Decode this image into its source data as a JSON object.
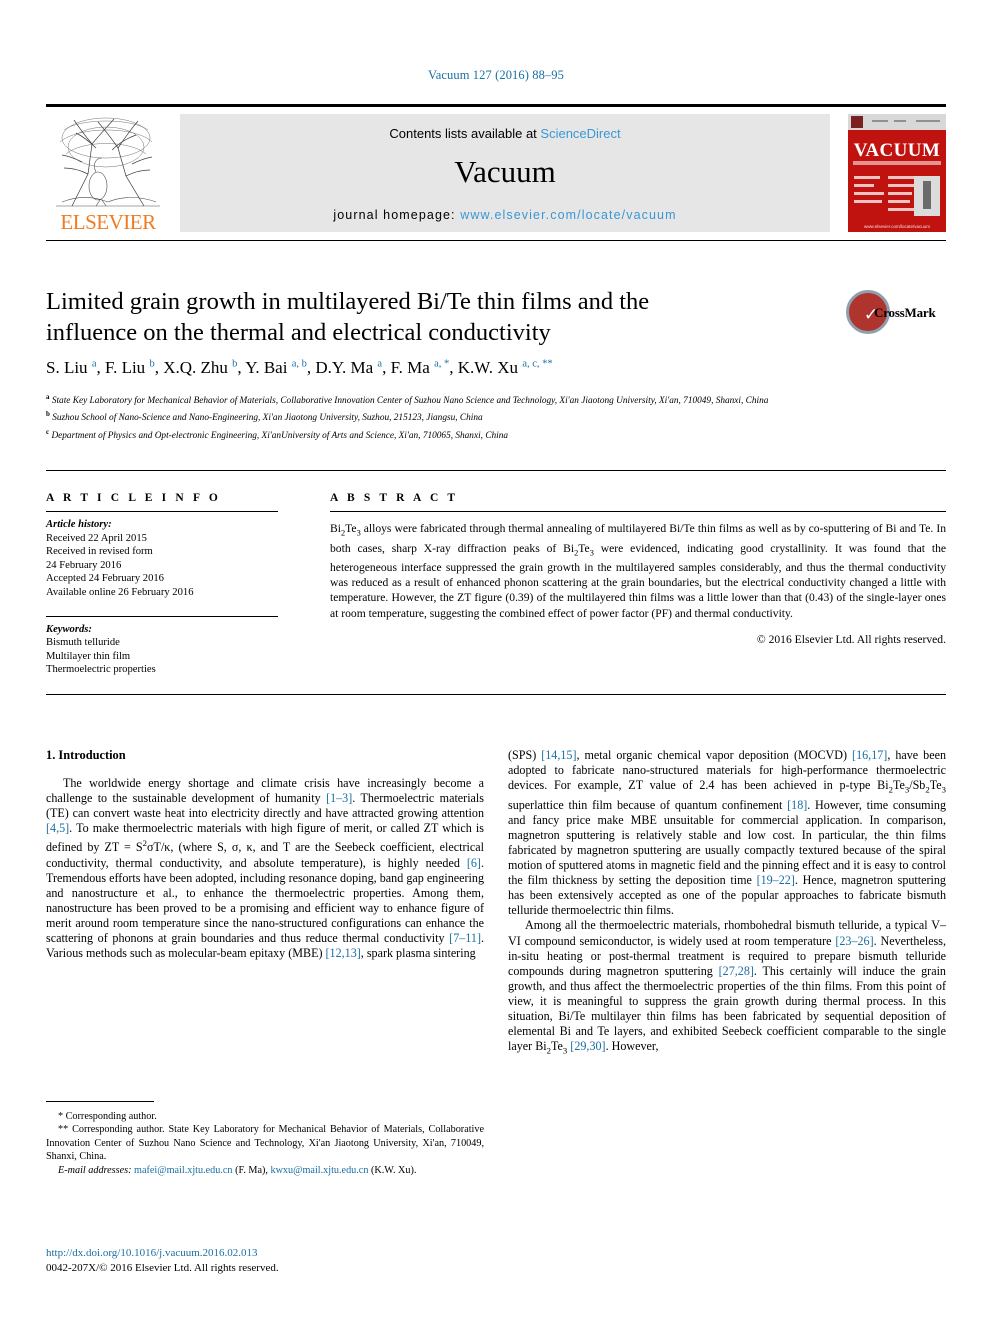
{
  "running_head": "Vacuum 127 (2016) 88–95",
  "journal_header": {
    "contents_prefix": "Contents lists available at ",
    "contents_link": "ScienceDirect",
    "journal_name": "Vacuum",
    "homepage_prefix": "journal homepage: ",
    "homepage_url": "www.elsevier.com/locate/vacuum",
    "publisher": "ELSEVIER",
    "cover_title": "VACUUM",
    "cover_caption": "www.elsevier.com/locate/vacuum",
    "accent_link_color": "#3a97d4",
    "elsevier_orange": "#ef7c22",
    "cover_red": "#c0130f"
  },
  "article": {
    "title": "Limited grain growth in multilayered Bi/Te thin films and the influence on the thermal and electrical conductivity",
    "crossmark_label": "CrossMark",
    "authors_html": "S. Liu <sup>a</sup>, F. Liu <sup>b</sup>, X.Q. Zhu <sup>b</sup>, Y. Bai <sup>a, b</sup>, D.Y. Ma <sup>a</sup>, F. Ma <sup>a, *</sup>, K.W. Xu <sup>a, c, **</sup>",
    "affiliations": [
      {
        "mark": "a",
        "text": "State Key Laboratory for Mechanical Behavior of Materials, Collaborative Innovation Center of Suzhou Nano Science and Technology, Xi'an Jiaotong University, Xi'an, 710049, Shanxi, China"
      },
      {
        "mark": "b",
        "text": "Suzhou School of Nano-Science and Nano-Engineering, Xi'an Jiaotong University, Suzhou, 215123, Jiangsu, China"
      },
      {
        "mark": "c",
        "text": "Department of Physics and Opt-electronic Engineering, Xi'anUniversity of Arts and Science, Xi'an, 710065, Shanxi, China"
      }
    ]
  },
  "article_info": {
    "heading": "A R T I C L E   I N F O",
    "history_label": "Article history:",
    "history": [
      "Received 22 April 2015",
      "Received in revised form",
      "24 February 2016",
      "Accepted 24 February 2016",
      "Available online 26 February 2016"
    ],
    "keywords_label": "Keywords:",
    "keywords": [
      "Bismuth telluride",
      "Multilayer thin film",
      "Thermoelectric properties"
    ]
  },
  "abstract": {
    "heading": "A B S T R A C T",
    "text_html": "Bi<sub>2</sub>Te<sub>3</sub> alloys were fabricated through thermal annealing of multilayered Bi/Te thin films as well as by co-sputtering of Bi and Te. In both cases, sharp X-ray diffraction peaks of Bi<sub>2</sub>Te<sub>3</sub> were evidenced, indicating good crystallinity. It was found that the heterogeneous interface suppressed the grain growth in the multilayered samples considerably, and thus the thermal conductivity was reduced as a result of enhanced phonon scattering at the grain boundaries, but the electrical conductivity changed a little with temperature. However, the ZT figure (0.39) of the multilayered thin films was a little lower than that (0.43) of the single-layer ones at room temperature, suggesting the combined effect of power factor (PF) and thermal conductivity.",
    "copyright": "© 2016 Elsevier Ltd. All rights reserved."
  },
  "body": {
    "section_title": "1. Introduction",
    "left_column_html": "The worldwide energy shortage and climate crisis have increasingly become a challenge to the sustainable development of humanity <span class=\"ref\">[1–3]</span>. Thermoelectric materials (TE) can convert waste heat into electricity directly and have attracted growing attention <span class=\"ref\">[4,5]</span>. To make thermoelectric materials with high figure of merit, or called ZT which is defined by ZT = S<sup class=\"n\">2</sup>σT/κ, (where S, σ, κ, and T are the Seebeck coefficient, electrical conductivity, thermal conductivity, and absolute temperature), is highly needed <span class=\"ref\">[6]</span>. Tremendous efforts have been adopted, including resonance doping, band gap engineering and nanostructure et al., to enhance the thermoelectric properties. Among them, nanostructure has been proved to be a promising and efficient way to enhance figure of merit around room temperature since the nano-structured configurations can enhance the scattering of phonons at grain boundaries and thus reduce thermal conductivity <span class=\"ref\">[7–11]</span>. Various methods such as molecular-beam epitaxy (MBE) <span class=\"ref\">[12,13]</span>, spark plasma sintering",
    "right_column_paragraph_1_html": "(SPS) <span class=\"ref\">[14,15]</span>, metal organic chemical vapor deposition (MOCVD) <span class=\"ref\">[16,17]</span>, have been adopted to fabricate nano-structured materials for high-performance thermoelectric devices. For example, ZT value of 2.4 has been achieved in p-type Bi<sub>2</sub>Te<sub>3</sub>/Sb<sub>2</sub>Te<sub>3</sub> superlattice thin film because of quantum confinement <span class=\"ref\">[18]</span>. However, time consuming and fancy price make MBE unsuitable for commercial application. In comparison, magnetron sputtering is relatively stable and low cost. In particular, the thin films fabricated by magnetron sputtering are usually compactly textured because of the spiral motion of sputtered atoms in magnetic field and the pinning effect and it is easy to control the film thickness by setting the deposition time <span class=\"ref\">[19–22]</span>. Hence, magnetron sputtering has been extensively accepted as one of the popular approaches to fabricate bismuth telluride thermoelectric thin films.",
    "right_column_paragraph_2_html": "Among all the thermoelectric materials, rhombohedral bismuth telluride, a typical V–VI compound semiconductor, is widely used at room temperature <span class=\"ref\">[23–26]</span>. Nevertheless, in-situ heating or post-thermal treatment is required to prepare bismuth telluride compounds during magnetron sputtering <span class=\"ref\">[27,28]</span>. This certainly will induce the grain growth, and thus affect the thermoelectric properties of the thin films. From this point of view, it is meaningful to suppress the grain growth during thermal process. In this situation, Bi/Te multilayer thin films has been fabricated by sequential deposition of elemental Bi and Te layers, and exhibited Seebeck coefficient comparable to the single layer Bi<sub>2</sub>Te<sub>3</sub> <span class=\"ref\">[29,30]</span>. However,"
  },
  "footnotes": {
    "note_1": "* Corresponding author.",
    "note_2": "** Corresponding author. State Key Laboratory for Mechanical Behavior of Materials, Collaborative Innovation Center of Suzhou Nano Science and Technology, Xi'an Jiaotong University, Xi'an, 710049, Shanxi, China.",
    "email_label": "E-mail addresses:",
    "email_1": "mafei@mail.xjtu.edu.cn",
    "email_1_owner": "(F. Ma)",
    "email_2": "kwxu@mail.xjtu.edu.cn",
    "email_2_owner": "(K.W. Xu).",
    "doi": "http://dx.doi.org/10.1016/j.vacuum.2016.02.013",
    "issn_line": "0042-207X/© 2016 Elsevier Ltd. All rights reserved."
  }
}
